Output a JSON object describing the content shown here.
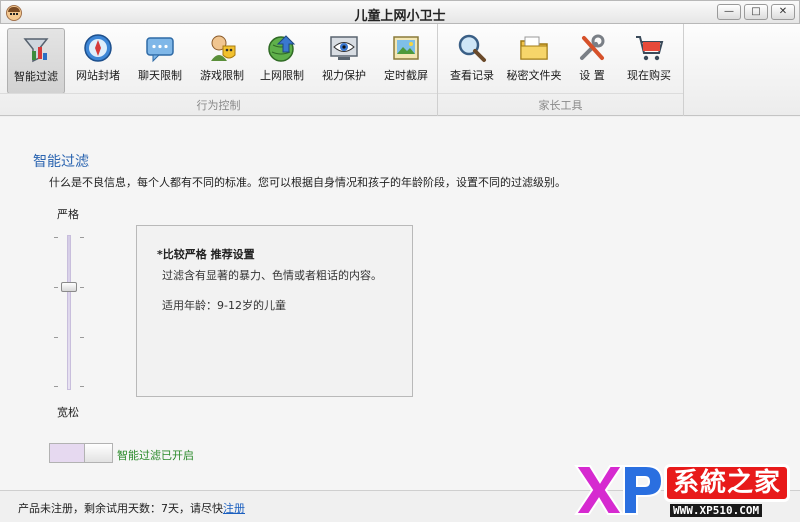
{
  "window": {
    "title": "儿童上网小卫士",
    "buttons": [
      "—",
      "□",
      "✕"
    ]
  },
  "toolbar": {
    "groups": [
      {
        "label": "行为控制"
      },
      {
        "label": "家长工具"
      }
    ],
    "items": [
      {
        "label": "智能过滤",
        "icon": "funnel-icon"
      },
      {
        "label": "网站封堵",
        "icon": "compass-icon"
      },
      {
        "label": "聊天限制",
        "icon": "chat-bubble-icon"
      },
      {
        "label": "游戏限制",
        "icon": "game-mask-icon"
      },
      {
        "label": "上网限制",
        "icon": "globe-arrow-icon"
      },
      {
        "label": "视力保护",
        "icon": "eye-icon"
      },
      {
        "label": "定时截屏",
        "icon": "screenshot-icon"
      },
      {
        "label": "查看记录",
        "icon": "magnifier-icon"
      },
      {
        "label": "秘密文件夹",
        "icon": "folder-icon"
      },
      {
        "label": "设  置",
        "icon": "tools-icon"
      },
      {
        "label": "现在购买",
        "icon": "shopping-cart-icon"
      }
    ],
    "active": "智能过滤"
  },
  "main": {
    "title": "智能过滤",
    "description": "什么是不良信息，每个人都有不同的标准。您可以根据自身情况和孩子的年龄阶段，设置不同的过滤级别。",
    "slider": {
      "top_label": "严格",
      "bottom_label": "宽松",
      "levels": 4,
      "selected_level": 2
    },
    "info": {
      "title": "*比较严格 推荐设置",
      "line1": "过滤含有显著的暴力、色情或者粗话的内容。",
      "line2": "适用年龄：9-12岁的儿童"
    },
    "toggle": {
      "label": "智能过滤已开启",
      "state": "on"
    }
  },
  "status": {
    "trial_text": "产品未注册，剩余试用天数：7天，请尽快",
    "register_link": "注册"
  },
  "watermark": {
    "logo_letters": "XP",
    "brand": "系統之家",
    "url": "WWW.XP510.COM"
  },
  "colors": {
    "accent_blue": "#2a64b0",
    "status_green": "#2a8a2a",
    "link_blue": "#1b5fbf",
    "watermark_red": "#e81a1a",
    "watermark_magenta": "#d62ad0"
  }
}
